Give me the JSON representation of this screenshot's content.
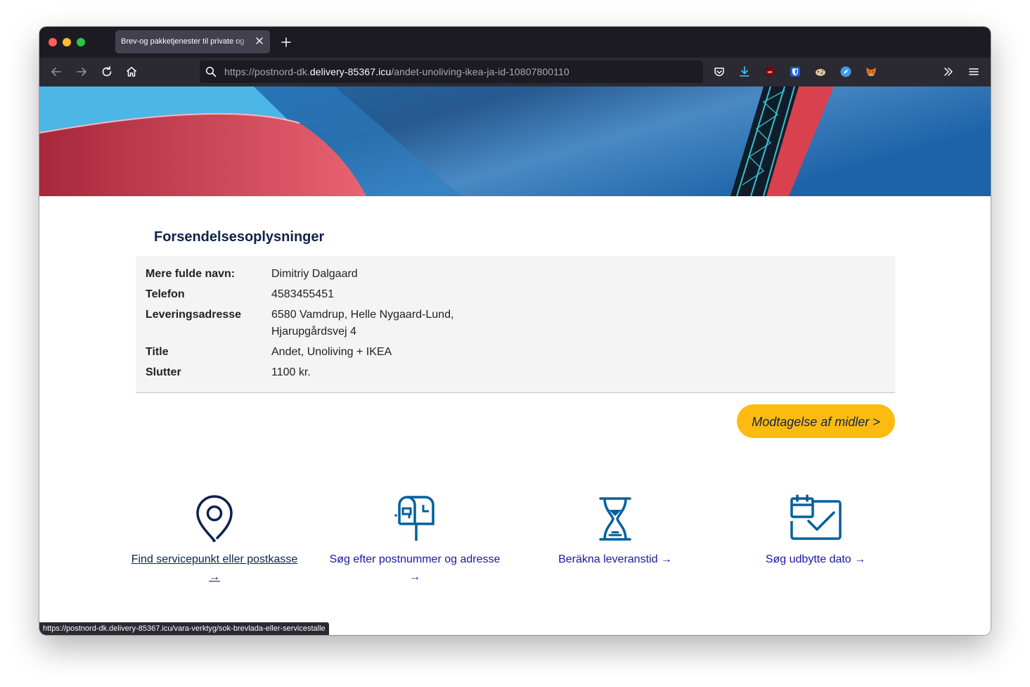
{
  "browser": {
    "tab_title": "Brev-og pakketjenester til private og",
    "url_prefix": "https://postnord-dk.",
    "url_host": "delivery-85367.icu",
    "url_path": "/andet-unoliving-ikea-ja-id-10807800110",
    "status_url": "https://postnord-dk.delivery-85367.icu/vara-verktyg/sok-brevlada-eller-servicestalle"
  },
  "shipment": {
    "title": "Forsendelsesoplysninger",
    "rows": [
      {
        "label": "Mere fulde navn:",
        "value": "Dimitriy Dalgaard"
      },
      {
        "label": "Telefon",
        "value": "4583455451"
      },
      {
        "label": "Leveringsadresse",
        "value": "6580 Vamdrup, Helle Nygaard-Lund,",
        "value2": "Hjarupgårdsvej 4"
      },
      {
        "label": "Title",
        "value": "Andet, Unoliving + IKEA"
      },
      {
        "label": "Slutter",
        "value": "1100 kr."
      }
    ]
  },
  "cta_label": "Modtagelse af midler >",
  "services": [
    {
      "line1": "Find servicepunkt eller postkasse",
      "line2": "→",
      "icon": "map-pin-icon"
    },
    {
      "line1": "Søg efter postnummer og adresse",
      "line2": "→",
      "icon": "mailbox-icon"
    },
    {
      "line1": "Beräkna leveranstid →",
      "icon": "hourglass-icon"
    },
    {
      "line1": "Søg udbytte dato →",
      "icon": "calendar-check-icon"
    }
  ],
  "colors": {
    "brand_navy": "#0d234b",
    "icon_blue": "#00609c",
    "cta_yellow": "#fdbb11",
    "link_blue": "#1818a8"
  }
}
